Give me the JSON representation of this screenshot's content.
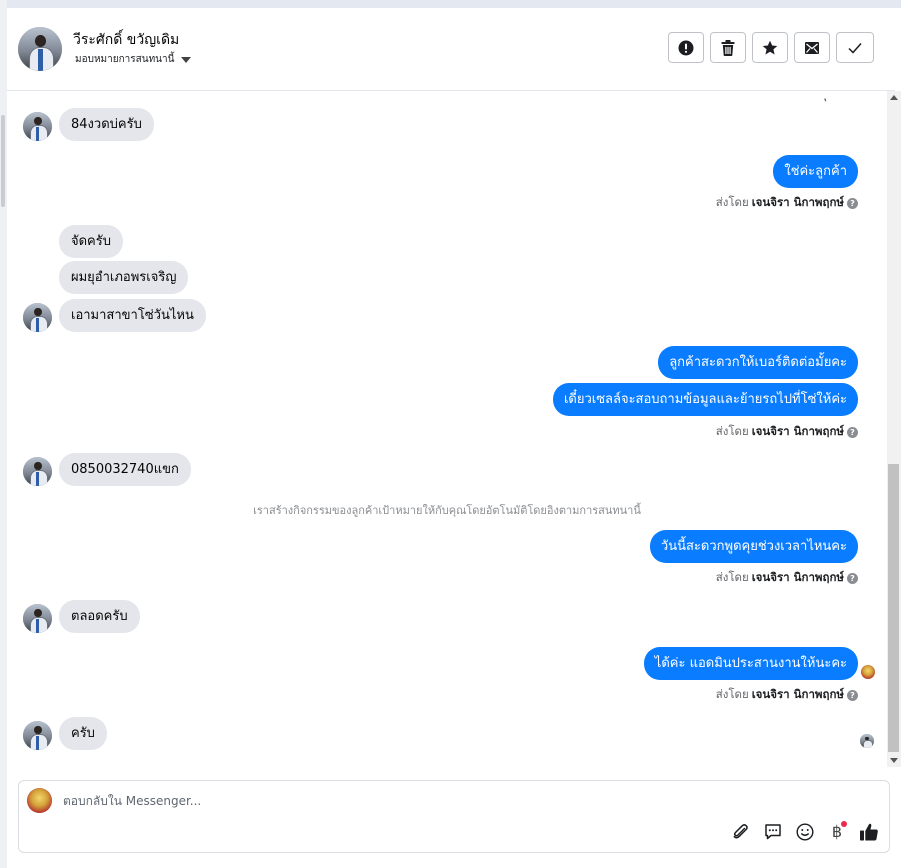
{
  "header": {
    "contact_name": "วีระศักดิ์ ขวัญเดิม",
    "assign_label": "มอบหมายการสนทนานี้",
    "actions": [
      {
        "name": "alert-button",
        "icon": "exclamation-circle-icon"
      },
      {
        "name": "delete-button",
        "icon": "trash-icon"
      },
      {
        "name": "star-button",
        "icon": "star-icon"
      },
      {
        "name": "mark-unread-button",
        "icon": "envelope-icon"
      },
      {
        "name": "done-button",
        "icon": "check-icon"
      }
    ]
  },
  "messages": {
    "m1": "84งวดบ่ครับ",
    "m2": "ใช่ค่ะลูกค้า",
    "m3": "จัดครับ",
    "m4": "ผมยุอำเภอพรเจริญ",
    "m5": "เอามาสาขาโซ่วันไหน",
    "m6": "ลูกค้าสะดวกให้เบอร์ติดต่อมั้ยคะ",
    "m7": "เดี๋ยวเซลล์จะสอบถามข้อมูลและย้ายรถไปที่โซ่ให้ค่ะ",
    "m8": "0850032740แขก",
    "system": "เราสร้างกิจกรรมของลูกค้าเป้าหมายให้กับคุณโดยอัตโนมัติโดยอิงตามการสนทนานี้",
    "m9": "วันนี้สะดวกพูดคุยช่วงเวลาไหนคะ",
    "m10": "ตลอดครับ",
    "m11": "ได้ค่ะ แอดมินประสานงานให้นะคะ",
    "m12": "ครับ",
    "partial_top": "ุ"
  },
  "sent_by": {
    "prefix": "ส่งโดย",
    "agent": "เจนจิรา นิกาพฤกษ์"
  },
  "composer": {
    "placeholder": "ตอบกลับใน Messenger...",
    "value": "",
    "currency_symbol": "฿"
  },
  "colors": {
    "outgoing_bubble": "#0a7cff",
    "incoming_bubble": "#e4e6eb",
    "notification_dot": "#f02849"
  }
}
